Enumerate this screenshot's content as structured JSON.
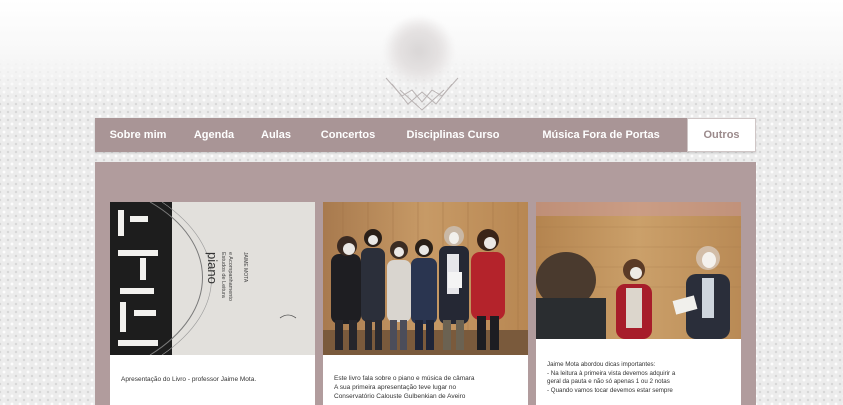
{
  "header": {
    "logo_icon": "blurred-site-logo"
  },
  "nav": {
    "items": [
      {
        "label": "Sobre mim",
        "active": false
      },
      {
        "label": "Agenda",
        "active": false
      },
      {
        "label": "Aulas",
        "active": false
      },
      {
        "label": "Concertos",
        "active": false
      },
      {
        "label": "Disciplinas Curso",
        "active": false
      },
      {
        "label": "Música Fora de Portas",
        "active": false
      },
      {
        "label": "Outros",
        "active": true
      }
    ]
  },
  "posts": [
    {
      "image_alt": "Capa do livro piano",
      "book_title": "piano",
      "book_subtitle_1": "Estudos de Leitura",
      "book_subtitle_2": "e Acompanhamento",
      "book_author": "JAIME MOTA",
      "caption_lines": [
        "Apresentação do Livro - professor Jaime Mota."
      ]
    },
    {
      "image_alt": "Grupo de alunos com o livro",
      "caption_lines": [
        "Este livro fala sobre o piano e música de câmara",
        "A sua primeira apresentação teve lugar no",
        "Conservatório Calouste Gulbenkian de Aveiro"
      ]
    },
    {
      "image_alt": "Jaime Mota com alunos",
      "caption_lines": [
        "Jaime Mota abordou dicas importantes:",
        "- Na leitura à primeira vista devemos adquirir a",
        "geral da pauta e não só apenas 1 ou 2 notas",
        "- Quando vamos tocar devemos estar sempre"
      ]
    }
  ],
  "colors": {
    "nav_bg": "#a99596",
    "panel_bg": "#b19c9d",
    "active_tab_text": "#9b8a8b"
  }
}
